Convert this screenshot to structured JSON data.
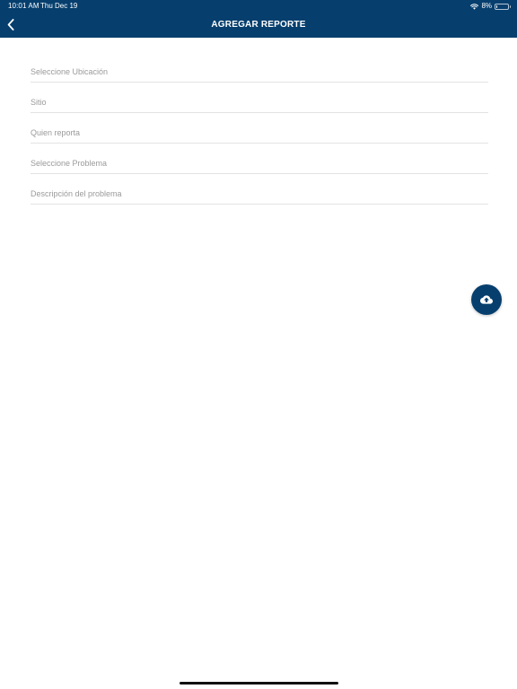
{
  "status_bar": {
    "time": "10:01 AM",
    "date": "Thu Dec 19",
    "battery_text": "8%",
    "battery_level": 0.08
  },
  "header": {
    "title": "AGREGAR REPORTE",
    "back_icon": "chevron-left-icon"
  },
  "form": {
    "fields": [
      {
        "placeholder": "Seleccione Ubicación",
        "value": ""
      },
      {
        "placeholder": "Sitio",
        "value": ""
      },
      {
        "placeholder": "Quien reporta",
        "value": ""
      },
      {
        "placeholder": "Seleccione Problema",
        "value": ""
      },
      {
        "placeholder": "Descripción del problema",
        "value": ""
      }
    ]
  },
  "upload_button": {
    "icon": "cloud-upload-icon"
  },
  "colors": {
    "brand": "#063f6e",
    "placeholder": "#9a9a9a",
    "divider": "#e3e3e3"
  }
}
